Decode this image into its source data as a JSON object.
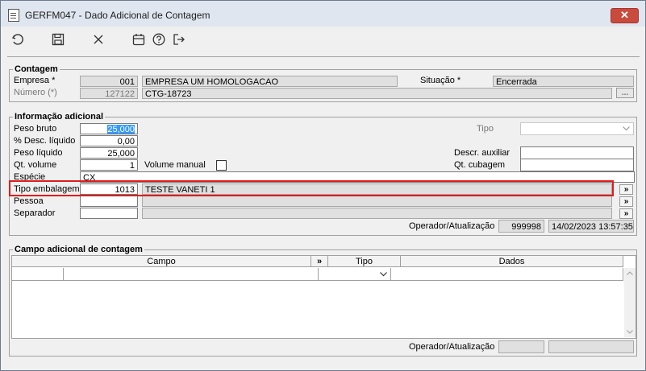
{
  "window": {
    "title": "GERFM047 - Dado Adicional de Contagem",
    "close_label": "✕"
  },
  "contagem": {
    "legend": "Contagem",
    "empresa_label": "Empresa *",
    "empresa_code": "001",
    "empresa_name": "EMPRESA UM HOMOLOGACAO",
    "situacao_label": "Situação *",
    "situacao_value": "Encerrada",
    "numero_label": "Número (*)",
    "numero_code": "127122",
    "numero_value": "CTG-18723",
    "lookup_icon": "..."
  },
  "info": {
    "legend": "Informação adicional",
    "peso_bruto_label": "Peso bruto",
    "peso_bruto_value": "25,000",
    "desc_liquido_label": "% Desc. líquido",
    "desc_liquido_value": "0,00",
    "peso_liquido_label": "Peso líquido",
    "peso_liquido_value": "25,000",
    "qt_volume_label": "Qt. volume",
    "qt_volume_value": "1",
    "volume_manual_label": "Volume manual",
    "especie_label": "Espécie",
    "especie_value": "CX",
    "tipo_embalagem_label": "Tipo embalagem",
    "tipo_embalagem_code": "1013",
    "tipo_embalagem_name": "TESTE VANETI 1",
    "pessoa_label": "Pessoa",
    "separador_label": "Separador",
    "tipo_label": "Tipo",
    "descr_auxiliar_label": "Descr. auxiliar",
    "qt_cubagem_label": "Qt. cubagem",
    "operador_label": "Operador/Atualização",
    "operador_value": "999998",
    "atualizacao_value": "14/02/2023 13:57:35",
    "lookup_label": "»"
  },
  "campo": {
    "legend": "Campo adicional de contagem",
    "columns": [
      "Campo",
      "»",
      "Tipo",
      "Dados"
    ],
    "operador_label": "Operador/Atualização"
  }
}
